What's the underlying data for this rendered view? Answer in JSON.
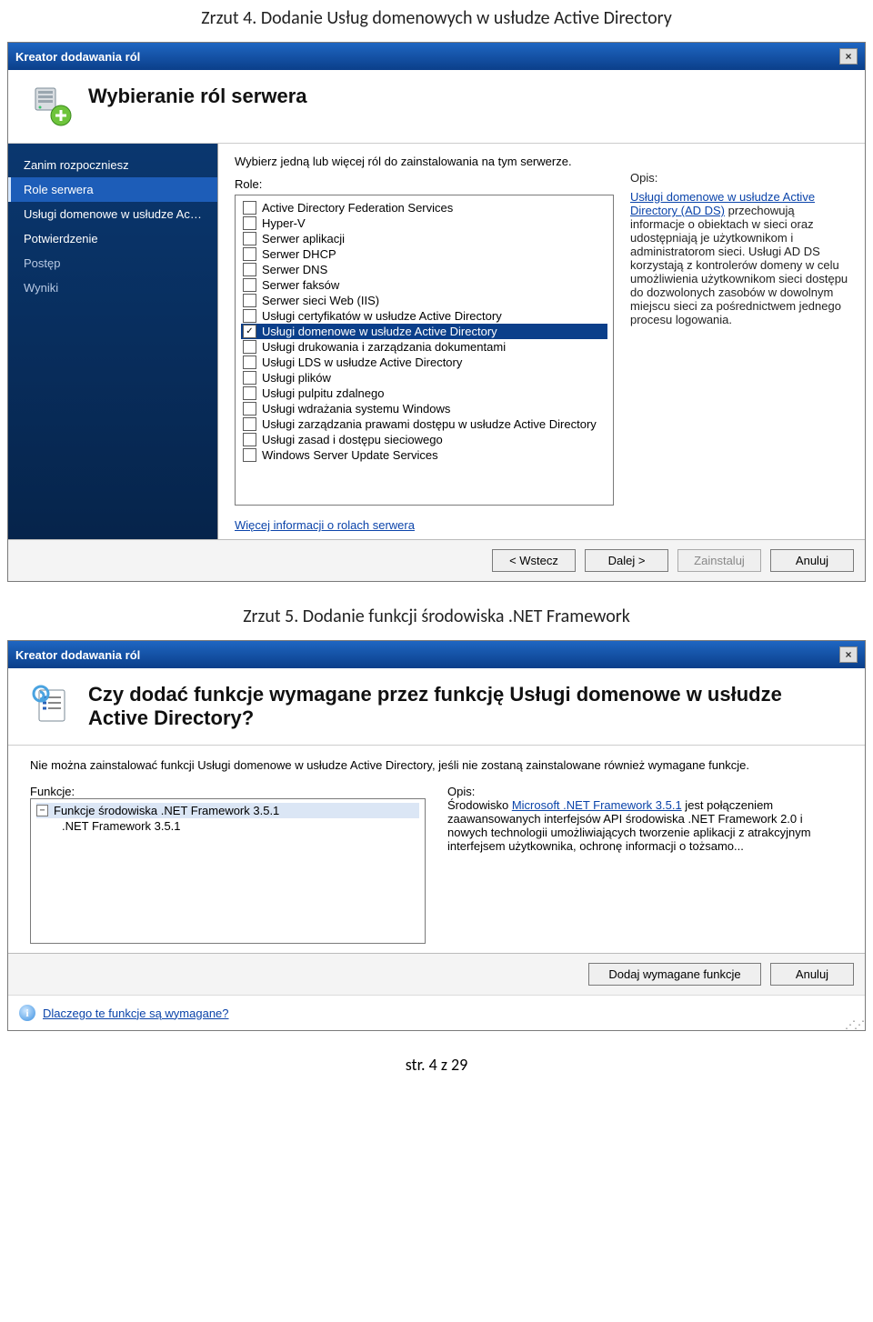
{
  "captions": {
    "caption1": "Zrzut 4. Dodanie Usług domenowych w usłudze Active Directory",
    "caption2": "Zrzut 5. Dodanie funkcji środowiska .NET Framework"
  },
  "win1": {
    "title": "Kreator dodawania ról",
    "header": "Wybieranie ról serwera",
    "sidebar": [
      {
        "label": "Zanim rozpoczniesz",
        "state": "normal"
      },
      {
        "label": "Role serwera",
        "state": "selected"
      },
      {
        "label": "Usługi domenowe w usłudze Acti...",
        "state": "normal"
      },
      {
        "label": "Potwierdzenie",
        "state": "normal"
      },
      {
        "label": "Postęp",
        "state": "dim"
      },
      {
        "label": "Wyniki",
        "state": "dim"
      }
    ],
    "instruction": "Wybierz jedną lub więcej ról do zainstalowania na tym serwerze.",
    "rolesLabel": "Role:",
    "roles": [
      {
        "name": "Active Directory Federation Services",
        "checked": false,
        "sel": false
      },
      {
        "name": "Hyper-V",
        "checked": false,
        "sel": false
      },
      {
        "name": "Serwer aplikacji",
        "checked": false,
        "sel": false
      },
      {
        "name": "Serwer DHCP",
        "checked": false,
        "sel": false
      },
      {
        "name": "Serwer DNS",
        "checked": false,
        "sel": false
      },
      {
        "name": "Serwer faksów",
        "checked": false,
        "sel": false
      },
      {
        "name": "Serwer sieci Web (IIS)",
        "checked": false,
        "sel": false
      },
      {
        "name": "Usługi certyfikatów w usłudze Active Directory",
        "checked": false,
        "sel": false
      },
      {
        "name": "Usługi domenowe w usłudze Active Directory",
        "checked": true,
        "sel": true
      },
      {
        "name": "Usługi drukowania i zarządzania dokumentami",
        "checked": false,
        "sel": false
      },
      {
        "name": "Usługi LDS w usłudze Active Directory",
        "checked": false,
        "sel": false
      },
      {
        "name": "Usługi plików",
        "checked": false,
        "sel": false
      },
      {
        "name": "Usługi pulpitu zdalnego",
        "checked": false,
        "sel": false
      },
      {
        "name": "Usługi wdrażania systemu Windows",
        "checked": false,
        "sel": false
      },
      {
        "name": "Usługi zarządzania prawami dostępu w usłudze Active Directory",
        "checked": false,
        "sel": false
      },
      {
        "name": "Usługi zasad i dostępu sieciowego",
        "checked": false,
        "sel": false
      },
      {
        "name": "Windows Server Update Services",
        "checked": false,
        "sel": false
      }
    ],
    "descLabel": "Opis:",
    "descTitle": "Usługi domenowe w usłudze Active Directory (AD DS)",
    "descBody": " przechowują informacje o obiektach w sieci oraz udostępniają je użytkownikom i administratorom sieci. Usługi AD DS korzystają z kontrolerów domeny w celu umożliwienia użytkownikom sieci dostępu do dozwolonych zasobów w dowolnym miejscu sieci za pośrednictwem jednego procesu logowania.",
    "moreInfoLink": "Więcej informacji o rolach serwera",
    "buttons": {
      "back": "< Wstecz",
      "next": "Dalej >",
      "install": "Zainstaluj",
      "cancel": "Anuluj"
    }
  },
  "win2": {
    "title": "Kreator dodawania ról",
    "header": "Czy dodać funkcje wymagane przez funkcję Usługi domenowe w usłudze Active Directory?",
    "desc": "Nie można zainstalować funkcji Usługi domenowe w usłudze Active Directory, jeśli nie zostaną zainstalowane również wymagane funkcje.",
    "funcLabel": "Funkcje:",
    "descLabel": "Opis:",
    "features": {
      "parent": "Funkcje środowiska .NET Framework 3.5.1",
      "child": ".NET Framework 3.5.1"
    },
    "descPrefix": "Środowisko ",
    "descLink": "Microsoft .NET Framework 3.5.1",
    "descBody": " jest połączeniem zaawansowanych interfejsów API środowiska .NET Framework 2.0 i nowych technologii umożliwiających tworzenie aplikacji z atrakcyjnym interfejsem użytkownika, ochronę informacji o tożsamo...",
    "buttons": {
      "add": "Dodaj wymagane funkcje",
      "cancel": "Anuluj"
    },
    "footerlink": "Dlaczego te funkcje są wymagane?"
  },
  "footer": "str. 4 z 29"
}
